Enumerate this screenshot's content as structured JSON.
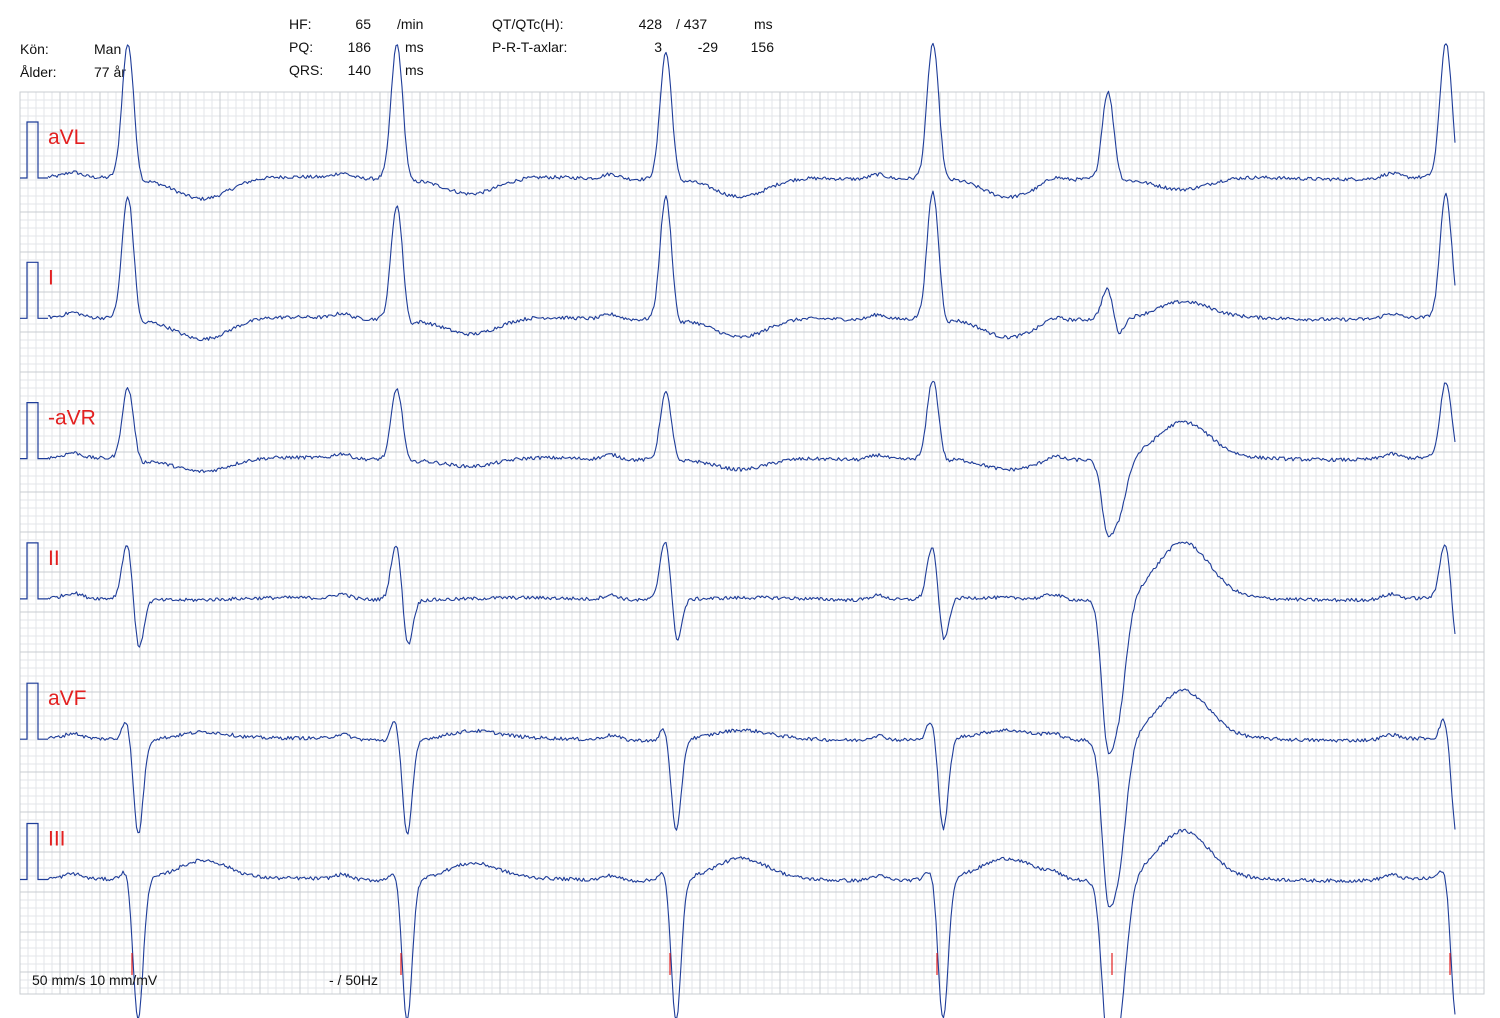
{
  "patient": {
    "sex_label": "Kön:",
    "sex_value": "Man",
    "age_label": "Ålder:",
    "age_value": "77 år"
  },
  "measurements": {
    "hf_label": "HF:",
    "hf_value": "65",
    "hf_unit": "/min",
    "pq_label": "PQ:",
    "pq_value": "186",
    "pq_unit": "ms",
    "qrs_label": "QRS:",
    "qrs_value": "140",
    "qrs_unit": "ms",
    "qt_label": "QT/QTc(H):",
    "qt_value": "428",
    "qtc_value": "/ 437",
    "qt_unit": "ms",
    "axes_label": "P-R-T-axlar:",
    "axis_p": "3",
    "axis_r": "-29",
    "axis_t": "156"
  },
  "footer": {
    "speed_gain": "50 mm/s 10 mm/mV",
    "filter": "- / 50Hz"
  },
  "colors": {
    "grid_minor": "#e3e6ea",
    "grid_major": "#c8ccd2",
    "trace": "#1f3d99",
    "label": "#e32020",
    "marker": "#e32020"
  },
  "chart_data": {
    "type": "line",
    "paper_speed_mm_s": 50,
    "gain_mm_mV": 10,
    "beat_times_px": [
      128,
      397,
      666,
      933,
      1108,
      1446
    ],
    "leads": [
      {
        "name": "aVL",
        "beats": [
          {
            "r": 1.7,
            "q": 0.05,
            "s": -0.1,
            "t": -0.25
          },
          {
            "r": 1.7,
            "q": 0.05,
            "s": -0.1,
            "t": -0.2
          },
          {
            "r": 1.6,
            "q": 0.05,
            "s": -0.1,
            "t": -0.25
          },
          {
            "r": 1.7,
            "q": 0.05,
            "s": -0.1,
            "t": -0.25
          },
          {
            "r": 1.1,
            "q": 0.05,
            "s": -0.05,
            "t": -0.15
          },
          {
            "r": 1.7,
            "q": 0.05,
            "s": -0.1,
            "t": -0.2
          }
        ]
      },
      {
        "name": "I",
        "beats": [
          {
            "r": 1.55,
            "q": 0.05,
            "s": -0.15,
            "t": -0.25
          },
          {
            "r": 1.45,
            "q": 0.05,
            "s": -0.15,
            "t": -0.2
          },
          {
            "r": 1.55,
            "q": 0.05,
            "s": -0.15,
            "t": -0.25
          },
          {
            "r": 1.6,
            "q": 0.05,
            "s": -0.15,
            "t": -0.25
          },
          {
            "r": 0.4,
            "q": 0.0,
            "s": -0.25,
            "t": 0.2
          },
          {
            "r": 1.55,
            "q": 0.05,
            "s": -0.1,
            "t": -0.2
          }
        ]
      },
      {
        "name": "-aVR",
        "beats": [
          {
            "r": 0.9,
            "q": 0.05,
            "s": -0.1,
            "t": -0.15
          },
          {
            "r": 0.9,
            "q": 0.05,
            "s": -0.1,
            "t": -0.1
          },
          {
            "r": 0.85,
            "q": 0.05,
            "s": -0.1,
            "t": -0.15
          },
          {
            "r": 1.0,
            "q": 0.05,
            "s": -0.1,
            "t": -0.15
          },
          {
            "r": -0.8,
            "q": 0.0,
            "s": -0.45,
            "t": 0.45
          },
          {
            "r": 0.95,
            "q": 0.05,
            "s": -0.1,
            "t": -0.1
          }
        ]
      },
      {
        "name": "II",
        "beats": [
          {
            "r": 0.75,
            "q": 0.05,
            "s": -0.75,
            "t": 0.0
          },
          {
            "r": 0.75,
            "q": 0.05,
            "s": -0.7,
            "t": 0.0
          },
          {
            "r": 0.8,
            "q": 0.05,
            "s": -0.65,
            "t": 0.0
          },
          {
            "r": 0.7,
            "q": 0.05,
            "s": -0.65,
            "t": 0.0
          },
          {
            "r": -1.6,
            "q": 0.0,
            "s": -0.9,
            "t": 0.7
          },
          {
            "r": 0.75,
            "q": 0.05,
            "s": -0.7,
            "t": 0.0
          }
        ]
      },
      {
        "name": "aVF",
        "beats": [
          {
            "r": 0.3,
            "q": 0.05,
            "s": -1.25,
            "t": 0.1
          },
          {
            "r": 0.3,
            "q": 0.05,
            "s": -1.25,
            "t": 0.1
          },
          {
            "r": 0.2,
            "q": 0.05,
            "s": -1.2,
            "t": 0.1
          },
          {
            "r": 0.3,
            "q": 0.05,
            "s": -1.2,
            "t": 0.1
          },
          {
            "r": -1.8,
            "q": 0.0,
            "s": -0.9,
            "t": 0.6
          },
          {
            "r": 0.3,
            "q": 0.05,
            "s": -1.25,
            "t": 0.1
          }
        ]
      },
      {
        "name": "III",
        "beats": [
          {
            "r": 0.15,
            "q": 0.0,
            "s": -1.8,
            "t": 0.25
          },
          {
            "r": 0.15,
            "q": 0.0,
            "s": -1.8,
            "t": 0.2
          },
          {
            "r": 0.15,
            "q": 0.0,
            "s": -1.8,
            "t": 0.25
          },
          {
            "r": 0.15,
            "q": 0.0,
            "s": -1.8,
            "t": 0.25
          },
          {
            "r": -2.0,
            "q": 0.0,
            "s": -0.9,
            "t": 0.6
          },
          {
            "r": 0.15,
            "q": 0.0,
            "s": -1.8,
            "t": 0.1
          }
        ]
      }
    ]
  }
}
